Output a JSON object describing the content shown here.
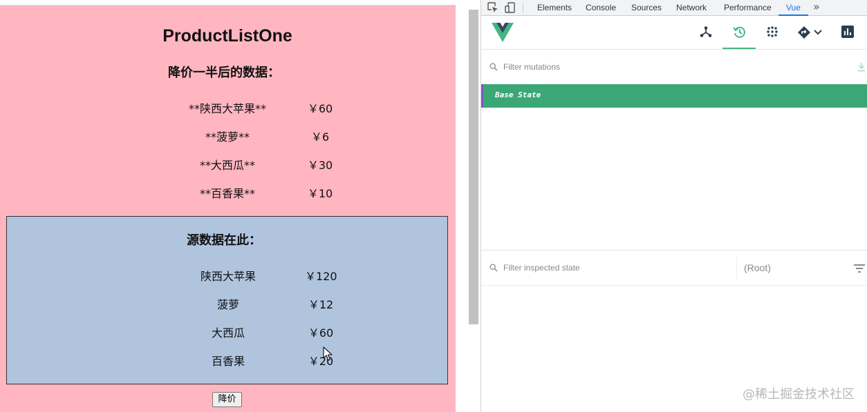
{
  "app": {
    "title": "ProductListOne",
    "discount_heading": "降价一半后的数据：",
    "discounted_products": [
      {
        "name": "**陕西大苹果**",
        "price": "￥60"
      },
      {
        "name": "**菠萝**",
        "price": "￥6"
      },
      {
        "name": "**大西瓜**",
        "price": "￥30"
      },
      {
        "name": "**百香果**",
        "price": "￥10"
      }
    ],
    "source_heading": "源数据在此：",
    "source_products": [
      {
        "name": "陕西大苹果",
        "price": "￥120"
      },
      {
        "name": "菠萝",
        "price": "￥12"
      },
      {
        "name": "大西瓜",
        "price": "￥60"
      },
      {
        "name": "百香果",
        "price": "￥20"
      }
    ],
    "reduce_button": "降价",
    "colors": {
      "pink": "#ffb6c1",
      "blue": "#b0c4de"
    }
  },
  "devtools": {
    "tabs": [
      "Elements",
      "Console",
      "Sources",
      "Network",
      "Performance",
      "Vue"
    ],
    "active_tab": "Vue",
    "more_label": "»",
    "toolbar_icons": [
      "inspect-element-icon",
      "device-toggle-icon"
    ],
    "vue": {
      "header_icons": [
        "components-icon",
        "timeline-history-icon",
        "vuex-icon",
        "router-icon",
        "chevron-down-icon",
        "performance-chart-icon"
      ],
      "active_view": "timeline-history-icon",
      "filter_mutations_placeholder": "Filter mutations",
      "mutations": [
        {
          "label": "Base State"
        }
      ],
      "filter_state_placeholder": "Filter inspected state",
      "root_label": "(Root)",
      "accent": "#3ba776"
    }
  },
  "watermark": "@稀土掘金技术社区"
}
